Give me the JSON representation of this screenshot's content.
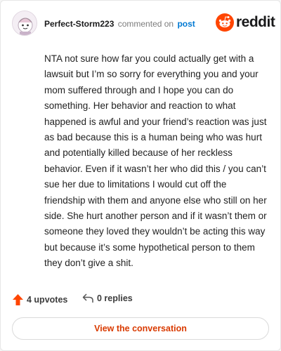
{
  "header": {
    "username": "Perfect-Storm223",
    "commented_text": "commented on",
    "post_link": "post",
    "logo_text": "reddit",
    "avatar": "snoo-avatar"
  },
  "comment": {
    "body": "NTA not sure how far you could actually get with a lawsuit but I’m so sorry for everything you and your mom suffered through and I hope you can do something. Her behavior and reaction to what happened is awful and your friend’s reaction was just as bad because this is a human being who was hurt and potentially killed because of her reckless behavior. Even if it wasn’t her who did this / you can’t sue her due to limitations I would cut off the friendship with them and anyone else who still on her side. She hurt another person and if it wasn’t them or someone they loved they wouldn’t be acting this way but because it’s some hypothetical person to them they don’t give a shit."
  },
  "actions": {
    "upvotes": "4 upvotes",
    "replies": "0 replies",
    "upvote_icon": "upvote-arrow-icon",
    "reply_icon": "reply-arrow-icon"
  },
  "footer": {
    "view_button": "View the conversation"
  },
  "colors": {
    "brand_orange": "#ff4500",
    "link_blue": "#0079d3",
    "button_text": "#d93a00"
  }
}
